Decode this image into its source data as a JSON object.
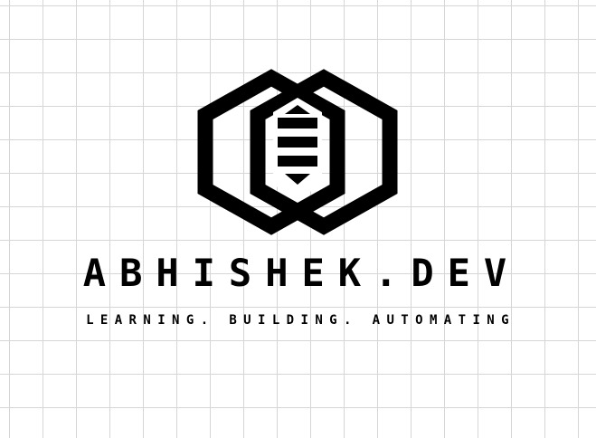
{
  "brand": {
    "name": "ABHISHEK.DEV",
    "tagline": "LEARNING. BUILDING. AUTOMATING"
  },
  "logo": {
    "icon": "double-hexagon-server-icon",
    "color": "#000000"
  },
  "background": {
    "color": "#ffffff",
    "grid_color": "#d6d6d6"
  }
}
